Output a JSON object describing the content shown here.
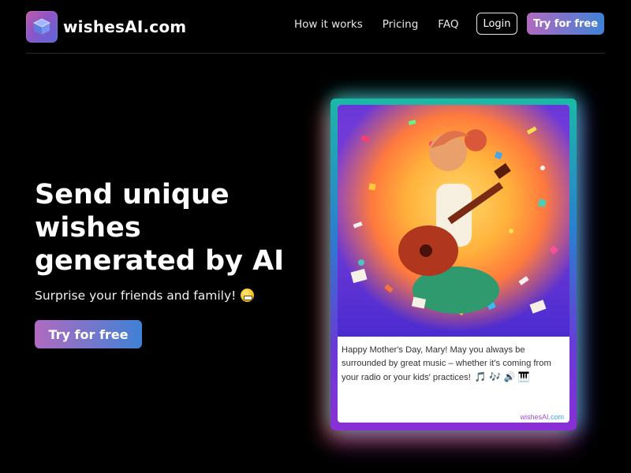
{
  "header": {
    "brand_name": "wishesAI.com",
    "logo_icon": "cube-icon",
    "nav": [
      "How it works",
      "Pricing",
      "FAQ"
    ],
    "login_label": "Login",
    "try_label": "Try for free"
  },
  "hero": {
    "title_lines": [
      "Send unique",
      "wishes",
      "generated by AI"
    ],
    "subtitle": "Surprise your friends and family!",
    "subtitle_emoji": "grinning-face-icon",
    "cta_label": "Try for free"
  },
  "card": {
    "image": "ai-generated-illustration-of-guitar-playing-figure",
    "message": "Happy Mother's Day, Mary! May you always be surrounded by great music – whether it's coming from your radio or your kids' practices!",
    "message_icons": "🎵 🎶 🔊 🎹",
    "brand_prefix": "wishesAI.",
    "brand_suffix": "com"
  },
  "colors": {
    "background": "#000000",
    "button_gradient_start": "#b06ac0",
    "button_gradient_end": "#3f82d6",
    "card_brand": "#9b4fd4"
  }
}
